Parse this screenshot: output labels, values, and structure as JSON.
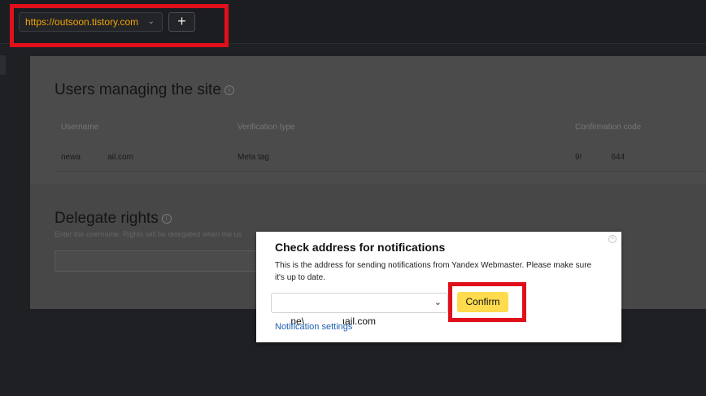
{
  "topbar": {
    "site_url": "https://outsoon.tistory.com",
    "add_label": "+"
  },
  "users_section": {
    "title": "Users managing the site",
    "columns": [
      "Username",
      "Verification type",
      "Confirmation code"
    ],
    "rows": [
      {
        "username": "newa            ail.com",
        "verification_type": "Meta tag",
        "confirmation_code": "9!             644"
      }
    ]
  },
  "delegate_section": {
    "title": "Delegate rights",
    "hint": "Enter the username. Rights will be delegated when the us"
  },
  "modal": {
    "title": "Check address for notifications",
    "description": "This is the address for sending notifications from Yandex Webmaster. Please make sure it's up to date.",
    "email_value": "ne\\              ıail.com",
    "confirm_label": "Confirm",
    "settings_link": "Notification settings"
  },
  "icons": {
    "info": "info-icon",
    "close": "close-icon",
    "chevron": "chevron-down-icon"
  },
  "colors": {
    "highlight": "#e0101b",
    "confirm_button": "#ffdb4d",
    "site_url_text": "#f0a500",
    "link": "#1e5fb3"
  }
}
